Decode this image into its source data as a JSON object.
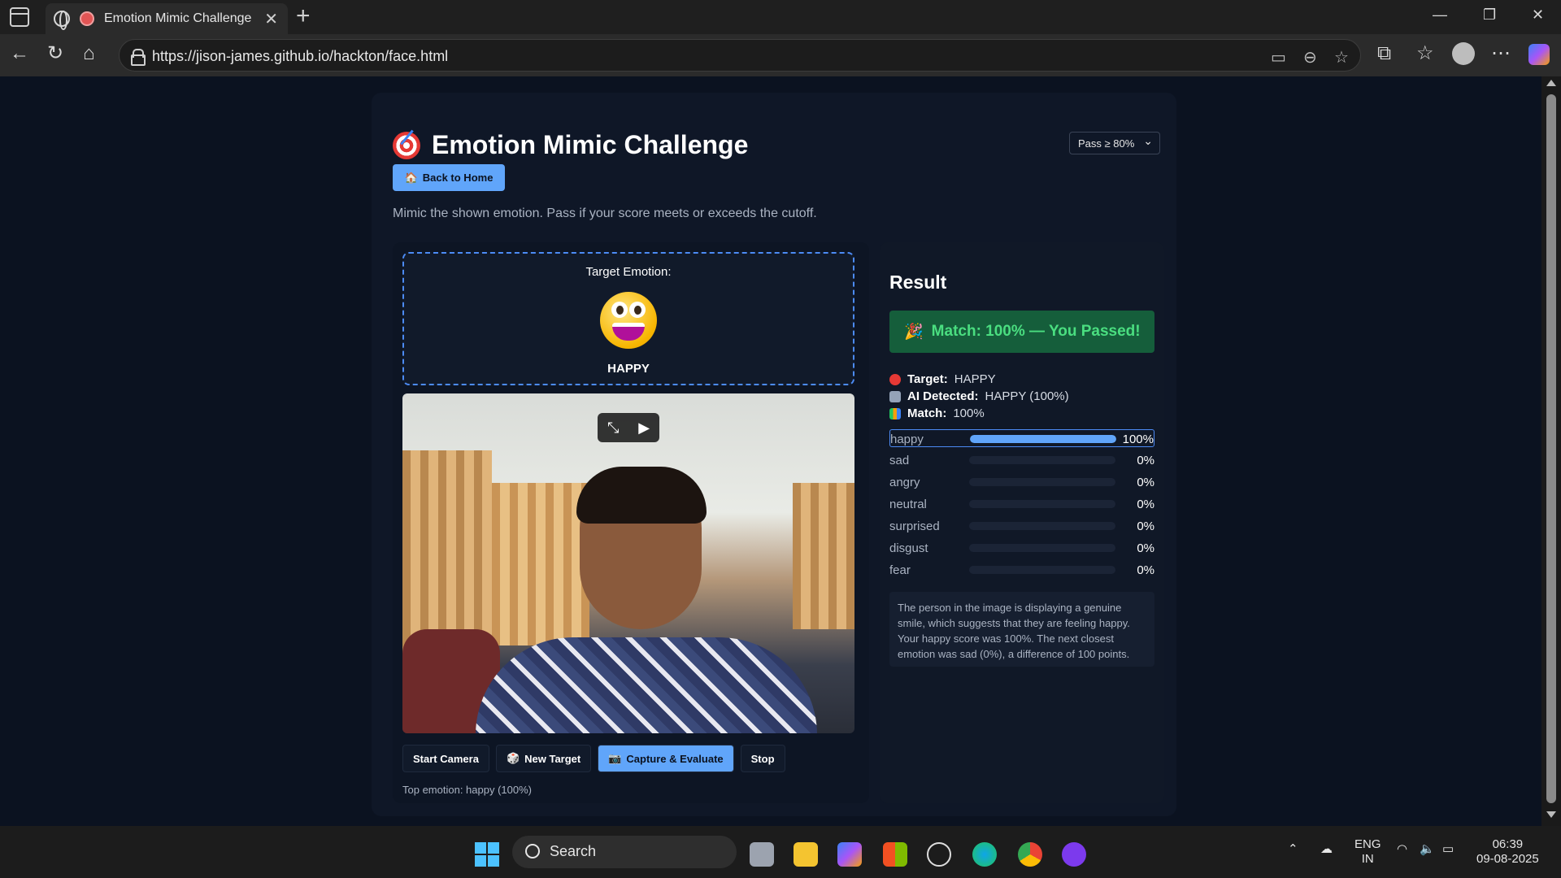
{
  "browser": {
    "tab_title": "Emotion Mimic Challenge",
    "url": "https://jison-james.github.io/hackton/face.html"
  },
  "page": {
    "title": "Emotion Mimic Challenge",
    "back_button": "Back to Home",
    "pass_select_value": "Pass ≥ 80%",
    "intro": "Mimic the shown emotion. Pass if your score meets or exceeds the cutoff.",
    "target_label": "Target Emotion:",
    "target_emotion": "HAPPY",
    "buttons": {
      "start_camera": "Start Camera",
      "new_target": "New Target",
      "capture": "Capture & Evaluate",
      "stop": "Stop"
    },
    "top_emotion": "Top emotion: happy (100%)"
  },
  "result": {
    "heading": "Result",
    "banner": "Match: 100% — You Passed!",
    "target_label": "Target:",
    "target_value": "HAPPY",
    "ai_label": "AI Detected:",
    "ai_value": "HAPPY (100%)",
    "match_label": "Match:",
    "match_value": "100%",
    "emotions": [
      {
        "name": "happy",
        "value": 100,
        "pct": "100%"
      },
      {
        "name": "sad",
        "value": 0,
        "pct": "0%"
      },
      {
        "name": "angry",
        "value": 0,
        "pct": "0%"
      },
      {
        "name": "neutral",
        "value": 0,
        "pct": "0%"
      },
      {
        "name": "surprised",
        "value": 0,
        "pct": "0%"
      },
      {
        "name": "disgust",
        "value": 0,
        "pct": "0%"
      },
      {
        "name": "fear",
        "value": 0,
        "pct": "0%"
      }
    ],
    "explanation": "The person in the image is displaying a genuine smile, which suggests that they are feeling happy. Your happy score was 100%. The next closest emotion was sad (0%), a difference of 100 points."
  },
  "taskbar": {
    "search": "Search",
    "lang_top": "ENG",
    "lang_bottom": "IN",
    "time": "06:39",
    "date": "09-08-2025"
  },
  "colors": {
    "accent": "#60a5fa",
    "pass_bg": "#155e3b",
    "pass_text": "#4ade80"
  }
}
